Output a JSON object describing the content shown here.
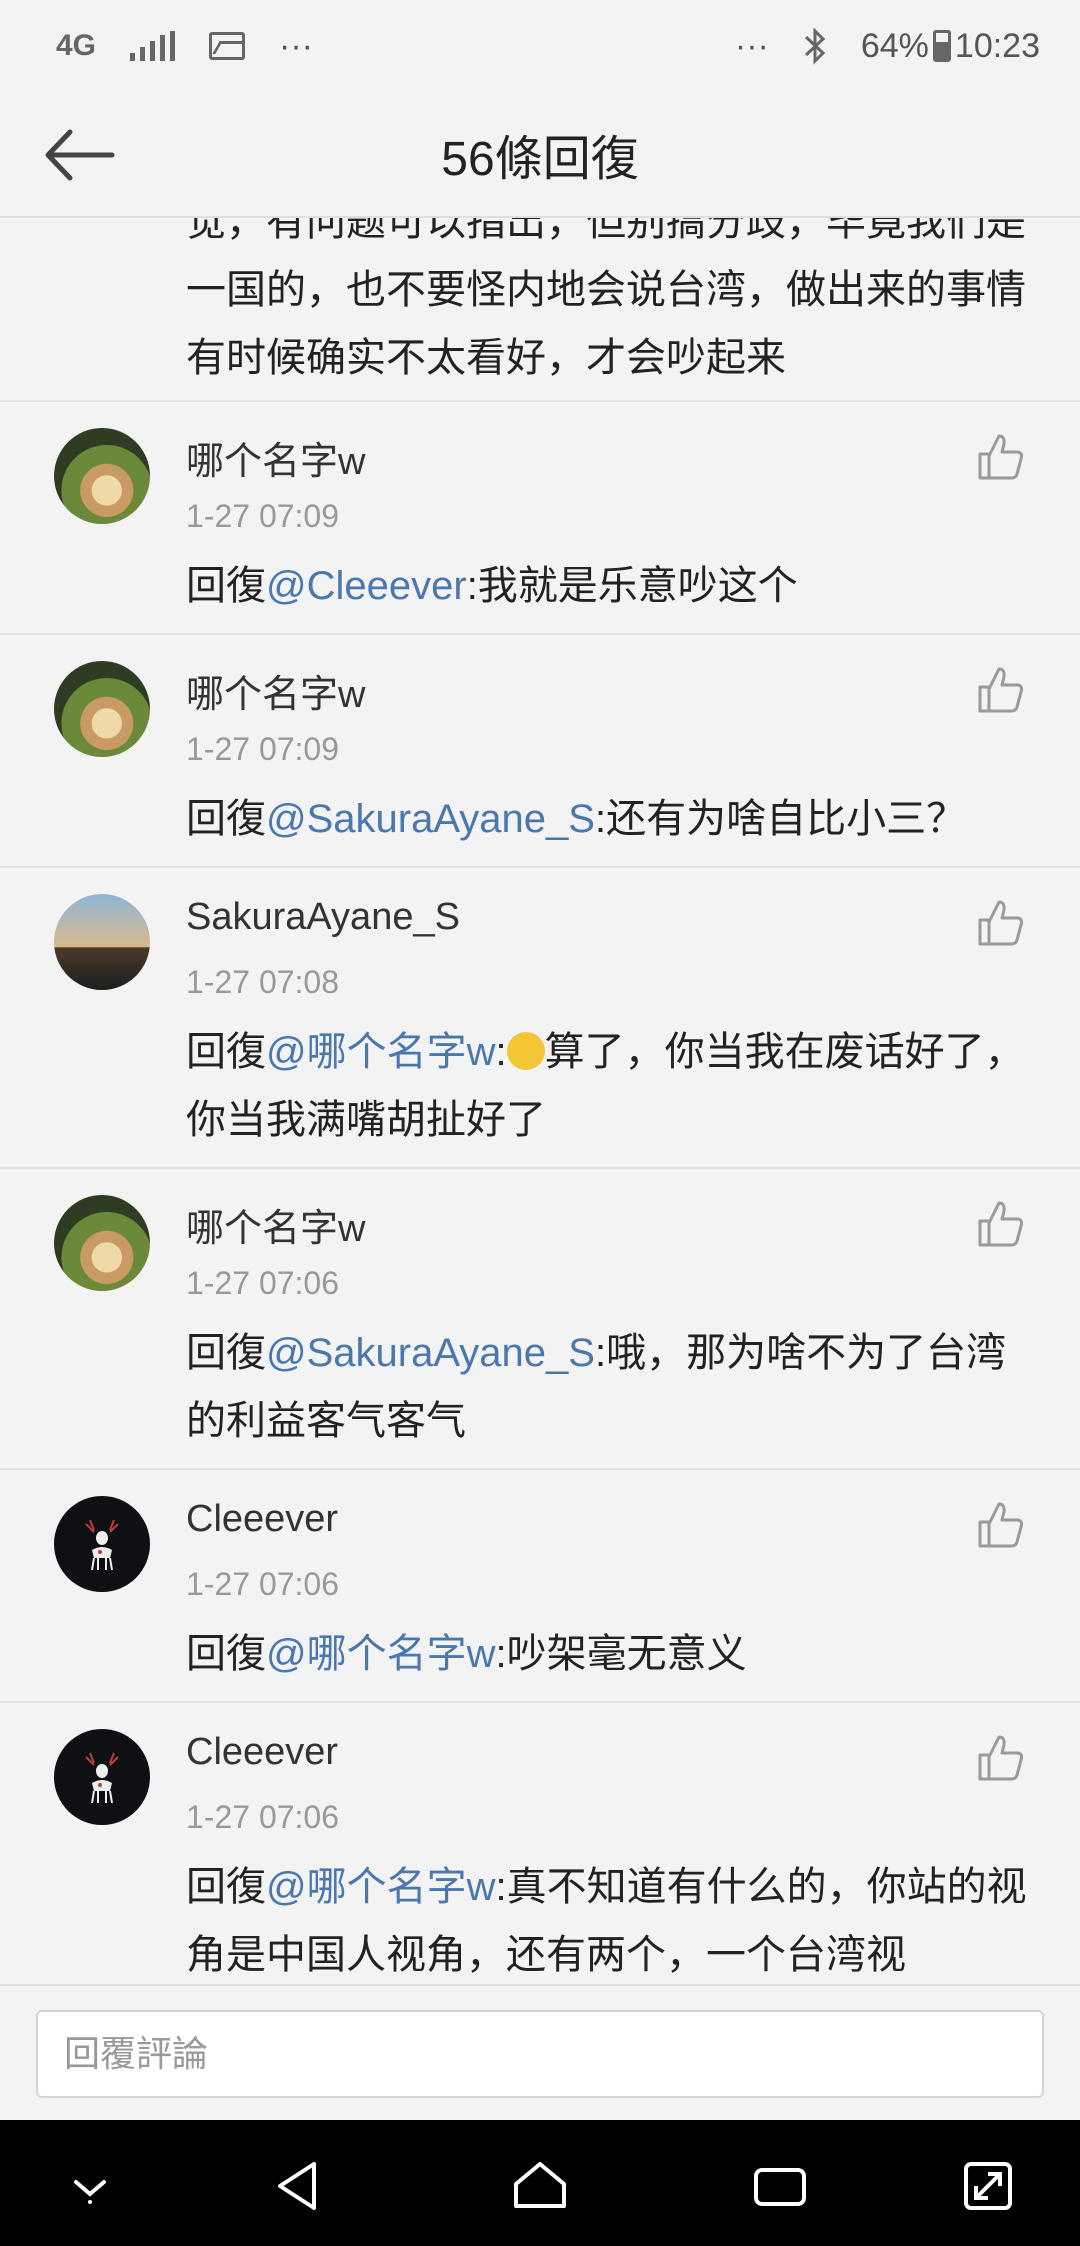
{
  "status": {
    "network": "4G",
    "more": "···",
    "more_right": "···",
    "battery_pct": "64%",
    "time": "10:23"
  },
  "header": {
    "title": "56條回復"
  },
  "partial_comment": {
    "text": "觉，有问题可以指出，但别搞分歧，毕竟我们是一国的，也不要怪内地会说台湾，做出来的事情有时候确实不太看好，才会吵起来"
  },
  "comments": [
    {
      "username": "哪个名字w",
      "time": "1-27 07:09",
      "prefix": "回復",
      "mention": "@Cleeever",
      "text": ":我就是乐意吵这个"
    },
    {
      "username": "哪个名字w",
      "time": "1-27 07:09",
      "prefix": "回復",
      "mention": "@SakuraAyane_S",
      "text": ":还有为啥自比小三？"
    },
    {
      "username": "SakuraAyane_S",
      "time": "1-27 07:08",
      "prefix": "回復",
      "mention": "@哪个名字w",
      "text": "算了，你当我在废话好了，你当我满嘴胡扯好了",
      "emoji": "smirk-emoji"
    },
    {
      "username": "哪个名字w",
      "time": "1-27 07:06",
      "prefix": "回復",
      "mention": "@SakuraAyane_S",
      "text": ":哦，那为啥不为了台湾的利益客气客气"
    },
    {
      "username": "Cleeever",
      "time": "1-27 07:06",
      "prefix": "回復",
      "mention": "@哪个名字w",
      "text": ":吵架毫无意义"
    },
    {
      "username": "Cleeever",
      "time": "1-27 07:06",
      "prefix": "回復",
      "mention": "@哪个名字w",
      "text": ":真不知道有什么的，你站的视角是中国人视角，还有两个，一个台湾视"
    }
  ],
  "reply": {
    "placeholder": "回覆評論"
  },
  "colors": {
    "mention": "#4a78ad",
    "background": "#f3f3f3",
    "nav": "#000000"
  }
}
